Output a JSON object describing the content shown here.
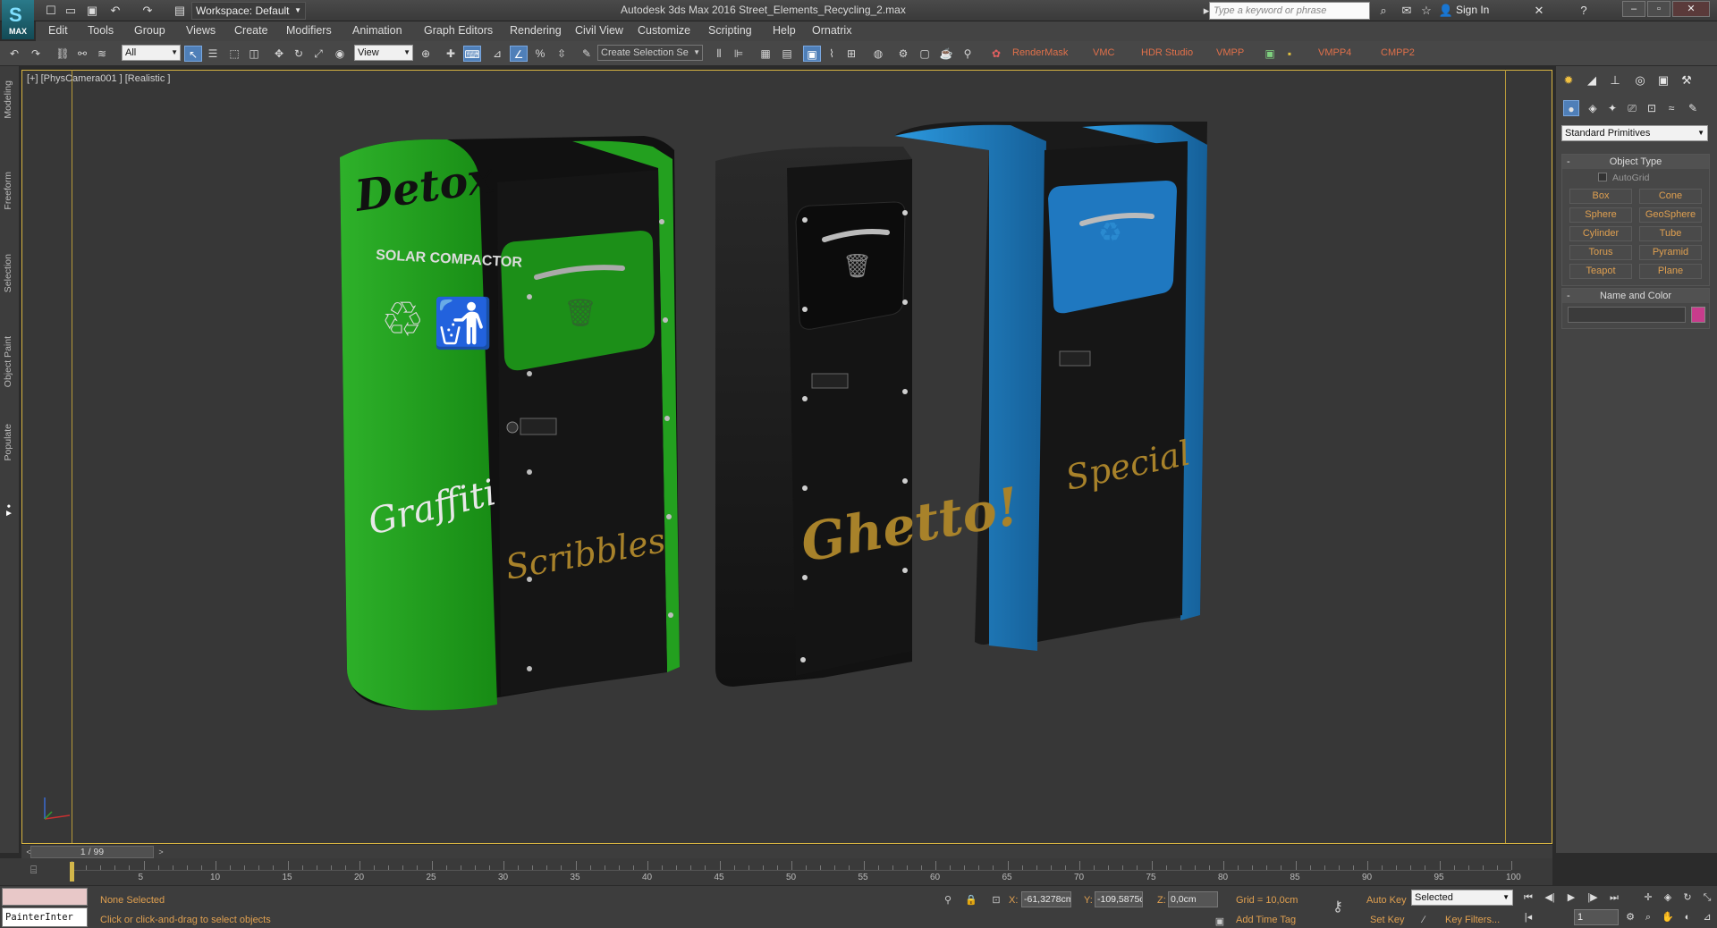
{
  "window": {
    "workspace": "Workspace: Default",
    "title": "Autodesk 3ds Max 2016    Street_Elements_Recycling_2.max",
    "search_placeholder": "Type a keyword or phrase",
    "sign_in": "Sign In",
    "logo": "MAX"
  },
  "menu": [
    "Edit",
    "Tools",
    "Group",
    "Views",
    "Create",
    "Modifiers",
    "Animation",
    "Graph Editors",
    "Rendering",
    "Civil View",
    "Customize",
    "Scripting",
    "Help",
    "Ornatrix"
  ],
  "toolbar": {
    "filter": "All",
    "ref_coord": "View",
    "selection_set_placeholder": "Create Selection Se",
    "plugins": [
      "RenderMask",
      "VMC",
      "HDR Studio",
      "VMPP",
      "VMPP4",
      "CMPP2"
    ]
  },
  "ribbon_tabs": [
    "Modeling",
    "Freeform",
    "Selection",
    "Object Paint",
    "Populate"
  ],
  "viewport": {
    "label": "[+] [PhysCamera001 ] [Realistic ]",
    "bins": [
      {
        "name": "green",
        "graffiti_top": "Detox",
        "brand": "SOLAR COMPACTOR",
        "tag": "Graffiti",
        "tag2": "Scribbles",
        "body_color": "#1f9a1a"
      },
      {
        "name": "black",
        "tag": "Ghetto!",
        "body_color": "#2a2a2a"
      },
      {
        "name": "blue",
        "tag": "Special",
        "body_color": "#1d7fc0"
      }
    ]
  },
  "command_panel": {
    "category": "Standard Primitives",
    "object_type_title": "Object Type",
    "autogrid": "AutoGrid",
    "primitives": [
      "Box",
      "Cone",
      "Sphere",
      "GeoSphere",
      "Cylinder",
      "Tube",
      "Torus",
      "Pyramid",
      "Teapot",
      "Plane"
    ],
    "name_color_title": "Name and Color",
    "object_color": "#c83c8c"
  },
  "timeline": {
    "frame_display": "1 / 99",
    "ticks": [
      "5",
      "10",
      "15",
      "20",
      "25",
      "30",
      "35",
      "40",
      "45",
      "50",
      "55",
      "60",
      "65",
      "70",
      "75",
      "80",
      "85",
      "90",
      "95",
      "100"
    ]
  },
  "status": {
    "maxscript_text": "PainterInter",
    "selection": "None Selected",
    "prompt": "Click or click-and-drag to select objects",
    "x_label": "X:",
    "x_value": "-61,3278cm",
    "y_label": "Y:",
    "y_value": "-109,5875c",
    "z_label": "Z:",
    "z_value": "0,0cm",
    "grid": "Grid = 10,0cm",
    "add_time_tag": "Add Time Tag",
    "auto_key": "Auto Key",
    "set_key": "Set Key",
    "selected_mode": "Selected",
    "key_filters": "Key Filters...",
    "current_frame": "1"
  }
}
